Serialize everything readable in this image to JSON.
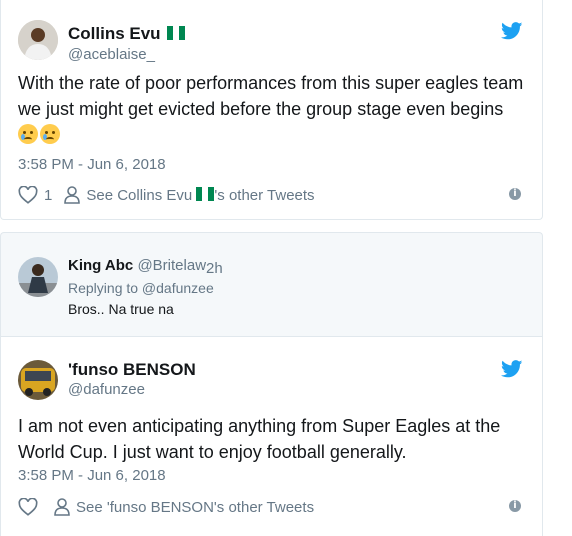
{
  "tweet1": {
    "name": "Collins Evu",
    "handle": "@aceblaise_",
    "text": "With the rate of poor performances from this super eagles team we just might get evicted before the group stage even begins",
    "timestamp": "3:58 PM - Jun 6, 2018",
    "like_count": "1",
    "see_other_prefix": "See Collins Evu",
    "see_other_suffix": "'s other Tweets"
  },
  "reply": {
    "name": "King Abc",
    "handle": "@Britelaw",
    "age": "2h",
    "replying_to": "Replying to @dafunzee",
    "text": "Bros.. Na true na"
  },
  "tweet2": {
    "name": "'funso BENSON",
    "handle": "@dafunzee",
    "text": "I am not even anticipating anything from Super Eagles at the World Cup. I just want to enjoy football generally.",
    "timestamp": "3:58 PM - Jun 6, 2018",
    "see_other": "See 'funso BENSON's other Tweets"
  },
  "colors": {
    "twitter_blue": "#1da1f2",
    "secondary_text": "#657786",
    "border": "#e1e8ed",
    "reply_bg": "#f5f8fa"
  },
  "icons": [
    "twitter-bird-icon",
    "heart-icon",
    "person-icon",
    "info-icon",
    "nigeria-flag-icon",
    "crying-face-emoji"
  ]
}
